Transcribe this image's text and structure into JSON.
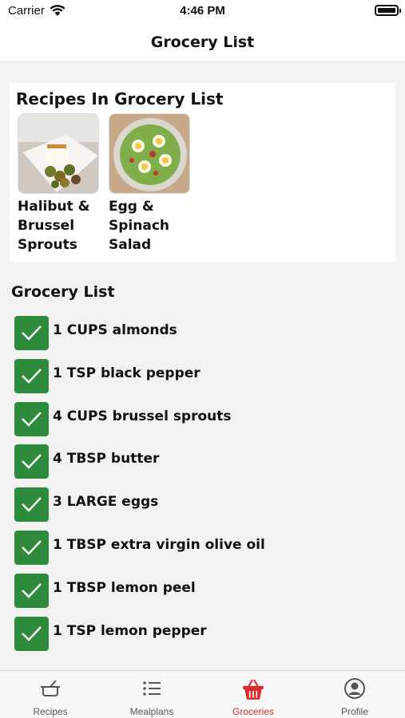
{
  "status_bar": {
    "carrier": "Carrier",
    "time": "4:46 PM"
  },
  "nav": {
    "title": "Grocery List"
  },
  "recipes_section": {
    "heading": "Recipes In Grocery List",
    "recipes": [
      {
        "name": "Halibut & Brussel Sprouts"
      },
      {
        "name": "Egg & Spinach Salad"
      }
    ]
  },
  "grocery_section": {
    "heading": "Grocery List",
    "items": [
      {
        "text": "1 CUPS almonds",
        "checked": true
      },
      {
        "text": "1 TSP black pepper",
        "checked": true
      },
      {
        "text": "4 CUPS brussel sprouts",
        "checked": true
      },
      {
        "text": "4 TBSP butter",
        "checked": true
      },
      {
        "text": "3 LARGE eggs",
        "checked": true
      },
      {
        "text": "1 TBSP extra virgin olive oil",
        "checked": true
      },
      {
        "text": "1 TBSP lemon peel",
        "checked": true
      },
      {
        "text": "1 TSP lemon pepper",
        "checked": true
      }
    ]
  },
  "tab_bar": {
    "tabs": [
      {
        "label": "Recipes",
        "icon": "pot-icon"
      },
      {
        "label": "Mealplans",
        "icon": "list-icon"
      },
      {
        "label": "Groceries",
        "icon": "basket-icon",
        "active": true
      },
      {
        "label": "Profile",
        "icon": "profile-icon"
      }
    ]
  },
  "colors": {
    "check_green": "#2e8b3c",
    "active_tab": "#d32f2f",
    "background": "#f2f2f2"
  }
}
